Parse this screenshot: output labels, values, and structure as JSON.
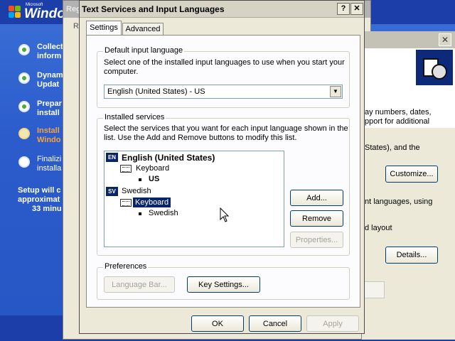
{
  "setup": {
    "logo_small": "Microsoft",
    "logo_word": "Windo",
    "steps": [
      {
        "line1": "Collect",
        "line2": "inform",
        "state": "done"
      },
      {
        "line1": "Dynam",
        "line2": "Updat",
        "state": "done"
      },
      {
        "line1": "Prepar",
        "line2": "install",
        "state": "done"
      },
      {
        "line1": "Install",
        "line2": "Windo",
        "state": "current"
      },
      {
        "line1": "Finalizi",
        "line2": "installa",
        "state": "pending"
      }
    ],
    "time_line1": "Setup will c",
    "time_line2": "approximat",
    "time_line3": "33 minu"
  },
  "regional": {
    "title_fragment": "Reg",
    "tab_fragment": "R"
  },
  "right_dialog": {
    "text1": "ay numbers, dates,",
    "text2": "pport for additional",
    "text3": "States), and the",
    "customize_label": "Customize...",
    "text4": "nt languages, using",
    "text5": "d layout",
    "details_label": "Details..."
  },
  "dialog": {
    "title": "Text Services and Input Languages",
    "help_glyph": "?",
    "close_glyph": "✕",
    "tabs": [
      {
        "label": "Settings",
        "selected": true
      },
      {
        "label": "Advanced",
        "selected": false
      }
    ],
    "default_input": {
      "group_label": "Default input language",
      "description_line1": "Select one of the installed input languages to use when you start your",
      "description_line2": "computer.",
      "selected_value": "English (United States) - US"
    },
    "installed_services": {
      "group_label": "Installed services",
      "description_line1": "Select the services that you want for each input language shown in the",
      "description_line2": "list. Use the Add and Remove buttons to modify this list.",
      "tree": [
        {
          "badge": "EN",
          "language": "English (United States)",
          "category": "Keyboard",
          "service": "US"
        },
        {
          "badge": "SV",
          "language": "Swedish",
          "category": "Keyboard",
          "service": "Swedish"
        }
      ],
      "add_label": "Add...",
      "remove_label": "Remove",
      "properties_label": "Properties..."
    },
    "preferences": {
      "group_label": "Preferences",
      "language_bar_label": "Language Bar...",
      "key_settings_label": "Key Settings..."
    },
    "ok_label": "OK",
    "cancel_label": "Cancel",
    "apply_label": "Apply"
  },
  "colors": {
    "setup_blue": "#2c5ccc",
    "dialog_face": "#ece9d8",
    "selection": "#0a246a",
    "current_step": "#f7a23a",
    "done_step": "#3fb13f"
  }
}
